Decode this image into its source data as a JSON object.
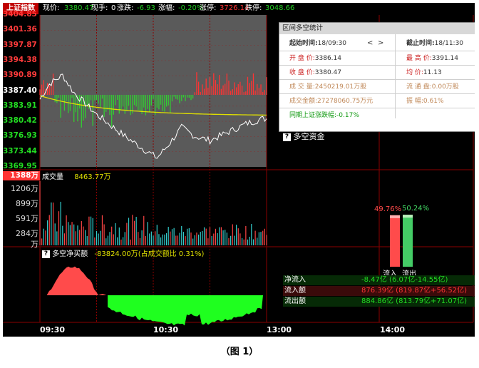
{
  "header": {
    "index_name": "上证指数",
    "price_label": "现价:",
    "price": "3380.47",
    "hand_label": "现手:",
    "hand": "0",
    "change_label": "涨跌:",
    "change": "-6.93",
    "pct_label": "涨幅:",
    "pct": "-0.20%",
    "limit_up_label": "涨停:",
    "limit_up": "3726.14",
    "limit_down_label": "跌停:",
    "limit_down": "3048.66"
  },
  "price_axis": {
    "labels": [
      "3404.85",
      "3401.36",
      "3397.87",
      "3394.38",
      "3390.89",
      "3387.40",
      "3383.91",
      "3380.42",
      "3376.93",
      "3373.44",
      "3369.95"
    ],
    "colors": [
      "#ff3b3b",
      "#ff3b3b",
      "#ff3b3b",
      "#ff3b3b",
      "#ff3b3b",
      "#ffffff",
      "#22dd22",
      "#22dd22",
      "#22dd22",
      "#22dd22",
      "#22dd22"
    ]
  },
  "volume": {
    "title": "成交量",
    "value": "8463.77万",
    "axis_top": "1388万",
    "axis_labels": [
      "1206万",
      "899万",
      "591万",
      "284万",
      "万"
    ]
  },
  "netflow": {
    "title": "多空净买额",
    "value": "-83824.00万(占成交额比 0.31%)"
  },
  "time_axis": [
    "09:30",
    "10:30",
    "13:00",
    "14:00"
  ],
  "stats_panel": {
    "title": "区间多空统计",
    "start_label": "起始时间:",
    "start_value": "18/09:30",
    "nav_prev": "<",
    "nav_next": ">",
    "end_label": "截止时间:",
    "end_value": "18/11:30",
    "open_label": "开 盘 价:",
    "open_value": "3386.14",
    "high_label": "最 高 价:",
    "high_value": "3391.14",
    "close_label": "收 盘 价:",
    "close_value": "3380.47",
    "avg_label": "均    价:",
    "avg_value": "11.13",
    "vol_label": "成 交 量:",
    "vol_value": "2450219.01万股",
    "float_label": "流 通 盘:",
    "float_value": "0.00万股",
    "amt_label": "成交金额:",
    "amt_value": "27278060.75万元",
    "amp_label": "振    幅:",
    "amp_value": "0.61%",
    "same_period_label": "同期上证涨跌幅:",
    "same_period_value": "-0.17%"
  },
  "capital_panel": {
    "title": "多空资金",
    "inflow_pct": 49.76,
    "outflow_pct": 50.24,
    "inflow_pct_label": "49.76%",
    "outflow_pct_label": "50.24%",
    "inflow_bar_label": "流入",
    "outflow_bar_label": "流出",
    "rows": [
      {
        "label": "净流入",
        "value": "-8.47亿 (6.07亿-14.55亿)"
      },
      {
        "label": "流入额",
        "value": "876.39亿 (819.87亿+56.52亿)"
      },
      {
        "label": "流出额",
        "value": "884.86亿 (813.79亿+71.07亿)"
      }
    ]
  },
  "figure_caption": "（图 1）",
  "colors": {
    "up": "#ff3333",
    "down": "#22cc22",
    "yellow_line": "#e0e000",
    "chart_bg": "#5a5a5a",
    "grid_red": "#8b0000"
  }
}
